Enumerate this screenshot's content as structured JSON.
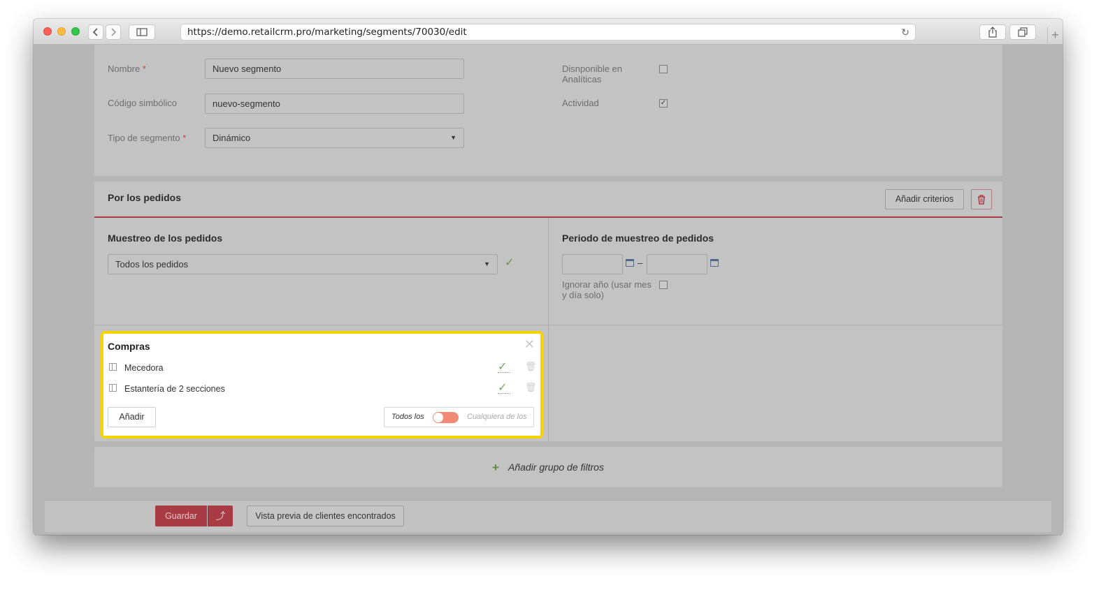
{
  "browser": {
    "url": "https://demo.retailcrm.pro/marketing/segments/70030/edit"
  },
  "form": {
    "name_label": "Nombre",
    "name_value": "Nuevo segmento",
    "code_label": "Código simbólico",
    "code_value": "nuevo-segmento",
    "type_label": "Tipo de segmento",
    "type_value": "Dinámico",
    "required_mark": "*",
    "analytics_label": "Disnponible en Analíticas",
    "analytics_checked": false,
    "activity_label": "Actividad",
    "activity_checked": true
  },
  "orders_section": {
    "title": "Por los pedidos",
    "add_criteria_label": "Añadir criterios",
    "sampling_title": "Muestreo de los pedidos",
    "sampling_value": "Todos los pedidos",
    "period_title": "Periodo de muestreo de pedidos",
    "date_from": "",
    "date_to": "",
    "date_separator": "–",
    "ignore_year_label": "Ignorar año (usar mes y día solo)",
    "ignore_year_checked": false
  },
  "purchases": {
    "title": "Compras",
    "items": [
      {
        "label": "Mecedora"
      },
      {
        "label": "Estantería de 2 secciones"
      }
    ],
    "add_label": "Añadir",
    "toggle_left": "Todos los",
    "toggle_right": "Cualquiera de los",
    "toggle_state": "Todos los"
  },
  "filters": {
    "add_group_label": "Añadir grupo de filtros"
  },
  "footer": {
    "save_label": "Guardar",
    "preview_label": "Vista previa de clientes encontrados"
  },
  "colors": {
    "accent": "#a83b44",
    "highlight": "#f5d400",
    "check": "#7aa35a",
    "toggle": "#f08a75"
  }
}
